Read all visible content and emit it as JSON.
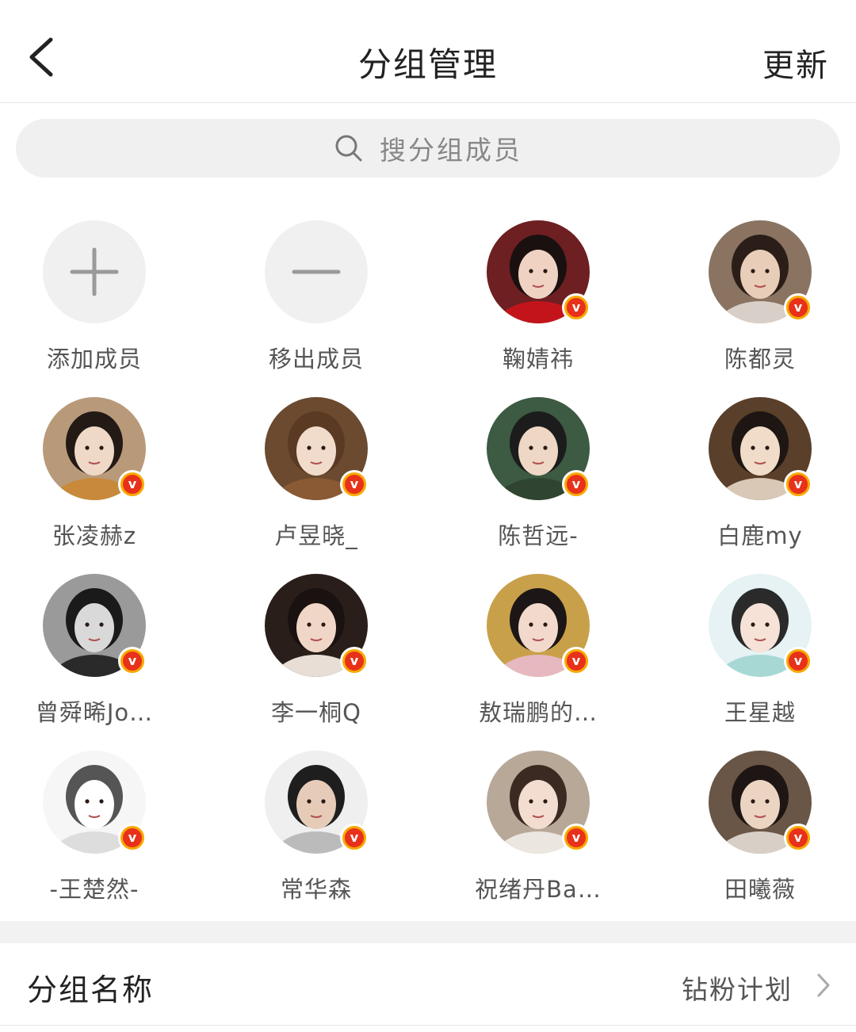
{
  "header": {
    "title": "分组管理",
    "refresh_label": "更新"
  },
  "search": {
    "placeholder": "搜分组成员"
  },
  "actions": [
    {
      "label": "添加成员",
      "icon": "plus-icon"
    },
    {
      "label": "移出成员",
      "icon": "minus-icon"
    }
  ],
  "members": [
    {
      "name": "鞠婧祎",
      "verified": true,
      "bg": "#6d1f22",
      "skin": "#f0d2c2",
      "hair": "#1a1010",
      "accent": "#c4141b"
    },
    {
      "name": "陈都灵",
      "verified": true,
      "bg": "#8a7360",
      "skin": "#e8cdb8",
      "hair": "#2b1e18",
      "accent": "#d8d0c8"
    },
    {
      "name": "张凌赫z",
      "verified": true,
      "bg": "#b89a7a",
      "skin": "#efd9c6",
      "hair": "#231a16",
      "accent": "#c88a3a"
    },
    {
      "name": "卢昱晓_",
      "verified": true,
      "bg": "#6b4a2f",
      "skin": "#f1dccb",
      "hair": "#5a3a22",
      "accent": "#8a5a35"
    },
    {
      "name": "陈哲远-",
      "verified": true,
      "bg": "#3d5a42",
      "skin": "#eed7c4",
      "hair": "#1c1c1c",
      "accent": "#2f4532"
    },
    {
      "name": "白鹿my",
      "verified": true,
      "bg": "#5a3f2a",
      "skin": "#f0dcc9",
      "hair": "#1e1612",
      "accent": "#d9c8b6"
    },
    {
      "name": "曾舜晞Jo…",
      "verified": true,
      "bg": "#9a9a9a",
      "skin": "#d9d9d9",
      "hair": "#1a1a1a",
      "accent": "#2a2a2a"
    },
    {
      "name": "李一桐Q",
      "verified": true,
      "bg": "#2a1e1a",
      "skin": "#f0d6c6",
      "hair": "#1a1210",
      "accent": "#e8ded6"
    },
    {
      "name": "敖瑞鹏的…",
      "verified": true,
      "bg": "#c9a04a",
      "skin": "#f2d9cc",
      "hair": "#1c1616",
      "accent": "#e6b8c0"
    },
    {
      "name": "王星越",
      "verified": true,
      "bg": "#e6f2f4",
      "skin": "#f6e2d6",
      "hair": "#2a2a2a",
      "accent": "#a8d8d4"
    },
    {
      "name": "-王楚然-",
      "verified": true,
      "bg": "#f6f6f6",
      "skin": "#ffffff",
      "hair": "#555555",
      "accent": "#dddddd"
    },
    {
      "name": "常华森",
      "verified": true,
      "bg": "#efefef",
      "skin": "#e6ccb8",
      "hair": "#1e1e1e",
      "accent": "#bbbbbb"
    },
    {
      "name": "祝绪丹Ba…",
      "verified": true,
      "bg": "#b8a898",
      "skin": "#f3ddd0",
      "hair": "#3a2a22",
      "accent": "#ece6e0"
    },
    {
      "name": "田曦薇",
      "verified": true,
      "bg": "#6a5646",
      "skin": "#ecd4c2",
      "hair": "#1e1614",
      "accent": "#d8d0c6"
    }
  ],
  "group_setting": {
    "label": "分组名称",
    "value": "钻粉计划"
  },
  "colors": {
    "badge_ring": "#f7a800",
    "badge_core": "#e8311a",
    "action_bg": "#f0f0f0"
  }
}
